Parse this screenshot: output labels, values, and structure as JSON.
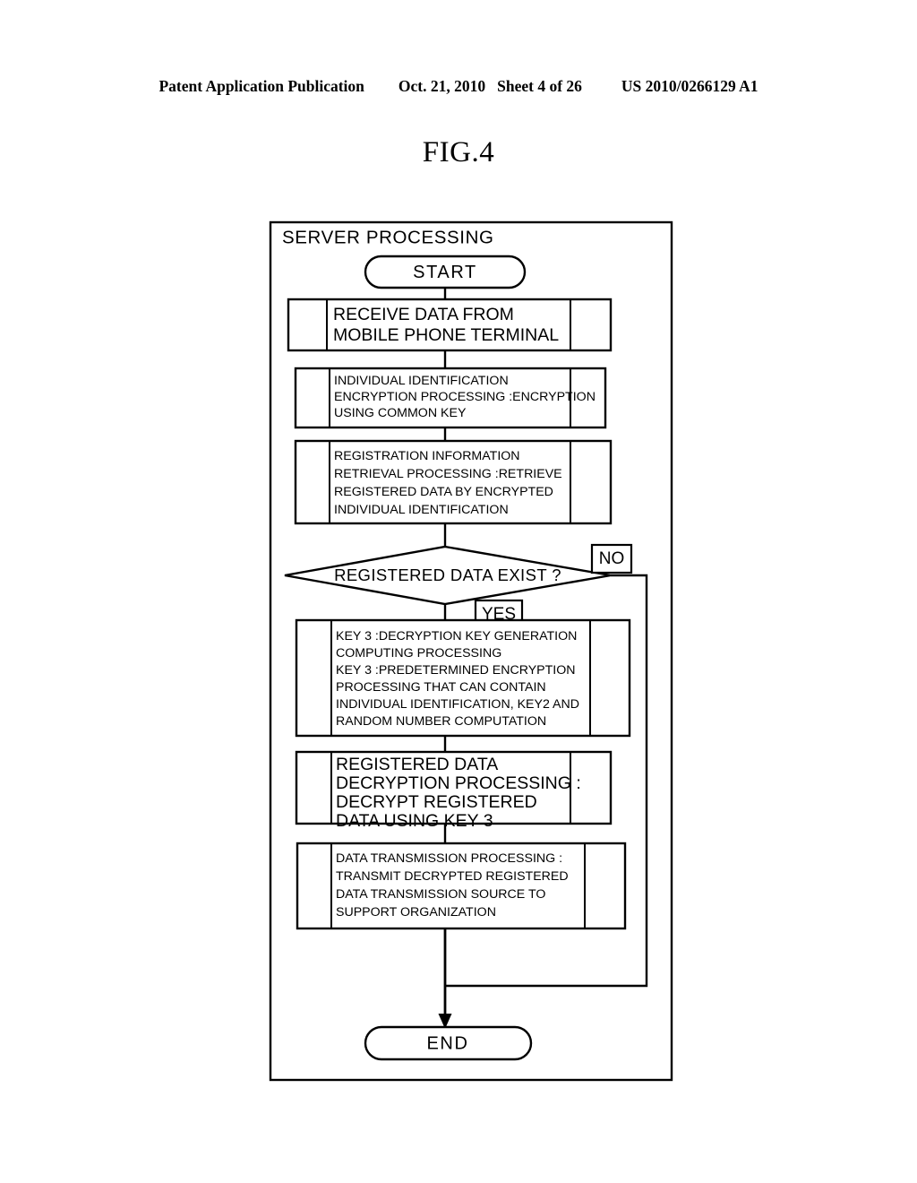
{
  "header": {
    "publication": "Patent Application Publication",
    "date": "Oct. 21, 2010",
    "sheet": "Sheet 4 of 26",
    "patent_number": "US 2010/0266129 A1"
  },
  "figure": {
    "title": "FIG.4",
    "panel_label": "SERVER PROCESSING"
  },
  "flowchart": {
    "start": "START",
    "end": "END",
    "decision": "REGISTERED DATA EXIST ?",
    "branch_yes": "YES",
    "branch_no": "NO",
    "steps": [
      {
        "id": "receive-data",
        "lines": [
          "RECEIVE DATA FROM",
          "MOBILE PHONE TERMINAL"
        ]
      },
      {
        "id": "individual-identification-encryption",
        "lines": [
          "INDIVIDUAL IDENTIFICATION",
          "ENCRYPTION PROCESSING :ENCRYPTION",
          "USING COMMON KEY"
        ]
      },
      {
        "id": "registration-information-retrieval",
        "lines": [
          "REGISTRATION INFORMATION",
          "RETRIEVAL PROCESSING :RETRIEVE",
          "REGISTERED DATA BY ENCRYPTED",
          "INDIVIDUAL IDENTIFICATION"
        ]
      },
      {
        "id": "key3-generation",
        "lines": [
          "KEY 3 :DECRYPTION KEY GENERATION",
          "COMPUTING PROCESSING",
          "KEY 3 :PREDETERMINED ENCRYPTION",
          "PROCESSING THAT CAN CONTAIN",
          "INDIVIDUAL IDENTIFICATION, KEY2 AND",
          "RANDOM NUMBER COMPUTATION"
        ]
      },
      {
        "id": "registered-data-decryption",
        "lines": [
          "REGISTERED DATA",
          "DECRYPTION PROCESSING :",
          "DECRYPT REGISTERED",
          "DATA USING KEY 3"
        ]
      },
      {
        "id": "data-transmission",
        "lines": [
          "DATA TRANSMISSION PROCESSING :",
          "TRANSMIT DECRYPTED REGISTERED",
          "DATA TRANSMISSION SOURCE TO",
          "SUPPORT ORGANIZATION"
        ]
      }
    ]
  },
  "colors": {
    "ink": "#000000",
    "paper": "#ffffff"
  }
}
